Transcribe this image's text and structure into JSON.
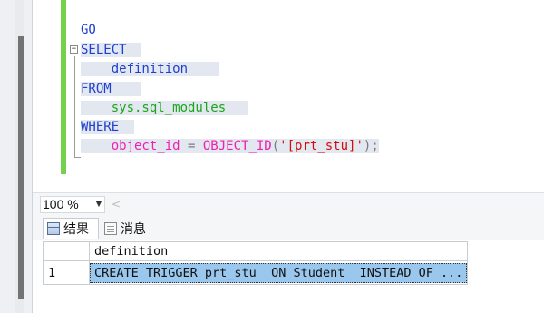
{
  "editor": {
    "lines": {
      "l1": {
        "go": "GO"
      },
      "l2": {
        "select": "SELECT"
      },
      "l3": {
        "definition": "definition"
      },
      "l4": {
        "from": "FROM"
      },
      "l5": {
        "source": "sys.sql_modules"
      },
      "l6": {
        "where": "WHERE"
      },
      "l7": {
        "col": "object_id",
        "eq": " = ",
        "fn": "OBJECT_ID",
        "lp": "(",
        "arg": "'[prt_stu]'",
        "rp": ")",
        "semi": ";"
      }
    },
    "collapse_glyph": "−"
  },
  "status": {
    "zoom": "100 %",
    "zoom_arrow": "▼",
    "scroll_left": "<"
  },
  "tabs": {
    "results": "结果",
    "messages": "消息"
  },
  "grid": {
    "column_header": "definition",
    "rows": [
      {
        "num": "1",
        "definition": "CREATE TRIGGER prt_stu  ON Student  INSTEAD OF ..."
      }
    ]
  },
  "colors": {
    "keyword": "#1f3fd2",
    "object": "#1aa61a",
    "function": "#ef1fb0",
    "string": "#d40b0b",
    "selection": "#99c7ee"
  }
}
